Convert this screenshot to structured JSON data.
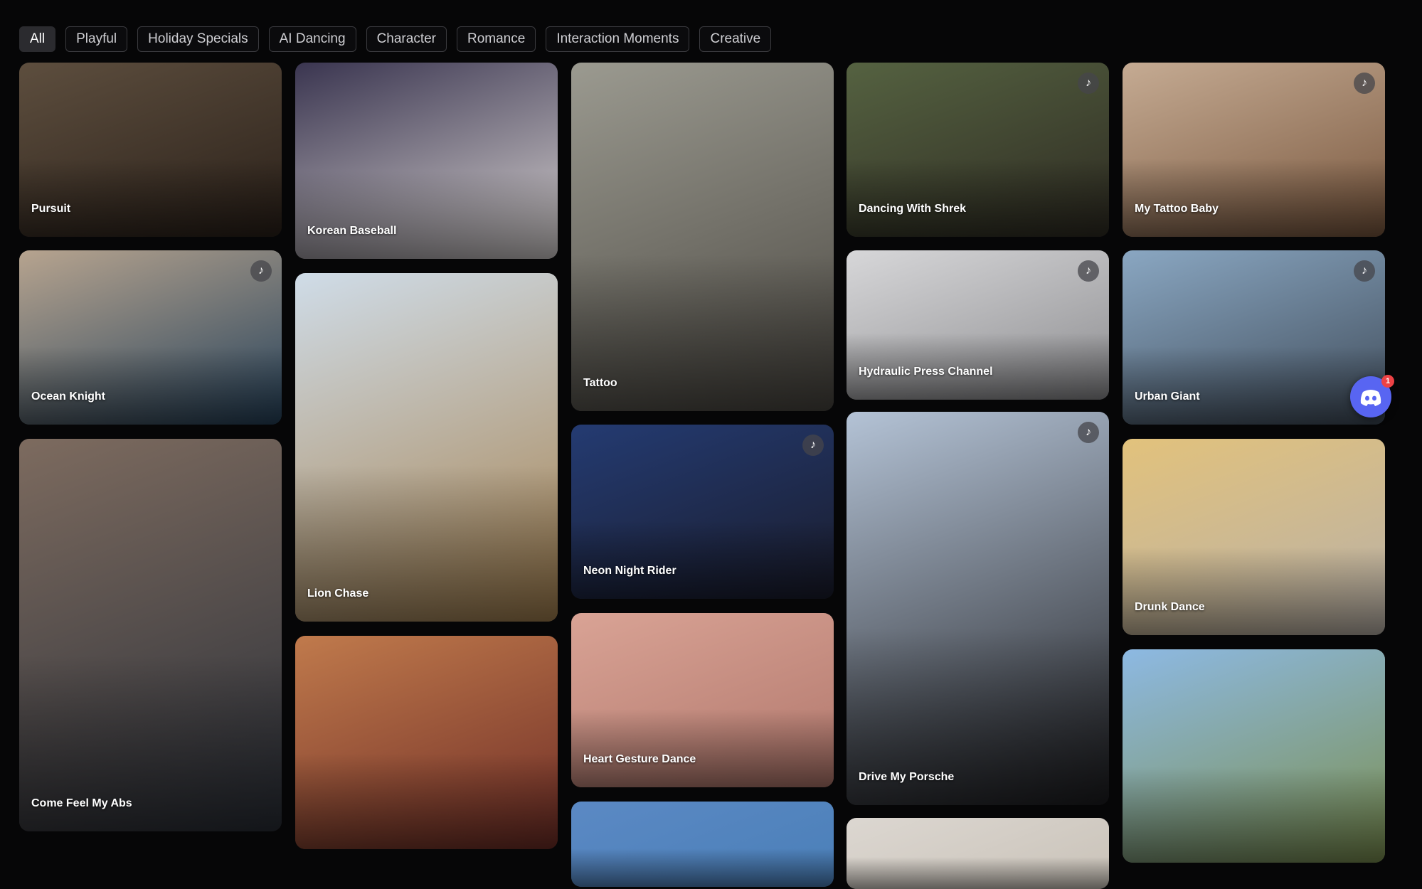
{
  "filters": [
    {
      "label": "All",
      "active": true
    },
    {
      "label": "Playful"
    },
    {
      "label": "Holiday Specials"
    },
    {
      "label": "AI Dancing"
    },
    {
      "label": "Character"
    },
    {
      "label": "Romance"
    },
    {
      "label": "Interaction Moments"
    },
    {
      "label": "Creative"
    }
  ],
  "columns": [
    [
      {
        "title": "Pursuit",
        "music": false,
        "colors": [
          "#5d4e3e",
          "#2a2019"
        ]
      },
      {
        "title": "Ocean Knight",
        "music": true,
        "colors": [
          "#b7a48f",
          "#25415a"
        ]
      },
      {
        "title": "Come Feel My Abs",
        "music": false,
        "colors": [
          "#7d6b5f",
          "#2a2f38"
        ]
      }
    ],
    [
      {
        "title": "Korean Baseball",
        "music": false,
        "colors": [
          "#3a3550",
          "#d6d1d0"
        ]
      },
      {
        "title": "Lion Chase",
        "music": false,
        "colors": [
          "#cfdce8",
          "#a5814f"
        ]
      },
      {
        "title": "",
        "music": false,
        "colors": [
          "#c07a4c",
          "#6f2d26"
        ]
      }
    ],
    [
      {
        "title": "Tattoo",
        "music": false,
        "colors": [
          "#9b9a90",
          "#4a4741"
        ]
      },
      {
        "title": "Neon Night Rider",
        "music": true,
        "colors": [
          "#243b72",
          "#1a1c2c"
        ]
      },
      {
        "title": "Heart Gesture Dance",
        "music": false,
        "colors": [
          "#d9a395",
          "#b1776c"
        ]
      },
      {
        "title": "",
        "music": false,
        "colors": [
          "#5b89c4",
          "#4a7fb8"
        ]
      }
    ],
    [
      {
        "title": "Dancing With Shrek",
        "music": true,
        "colors": [
          "#556241",
          "#2e2b22"
        ]
      },
      {
        "title": "Hydraulic Press Channel",
        "music": true,
        "colors": [
          "#d7d7d9",
          "#8d8d90"
        ]
      },
      {
        "title": "Drive My Porsche",
        "music": true,
        "colors": [
          "#b4c3d6",
          "#1d1d20"
        ]
      },
      {
        "title": "",
        "music": false,
        "colors": [
          "#dcd7d1",
          "#c9c2b8"
        ]
      }
    ],
    [
      {
        "title": "My Tattoo Baby",
        "music": true,
        "colors": [
          "#c5ab93",
          "#79573e"
        ]
      },
      {
        "title": "Urban Giant",
        "music": true,
        "colors": [
          "#8aa7c2",
          "#3f4b59"
        ]
      },
      {
        "title": "Drunk Dance",
        "music": false,
        "colors": [
          "#e2c27c",
          "#b8b0a7"
        ]
      },
      {
        "title": "",
        "music": false,
        "colors": [
          "#8db9e3",
          "#7b8f4f"
        ]
      }
    ]
  ],
  "icons": {
    "music": "music-note-icon",
    "discord": "discord-icon"
  },
  "discord_notification_count": "1"
}
